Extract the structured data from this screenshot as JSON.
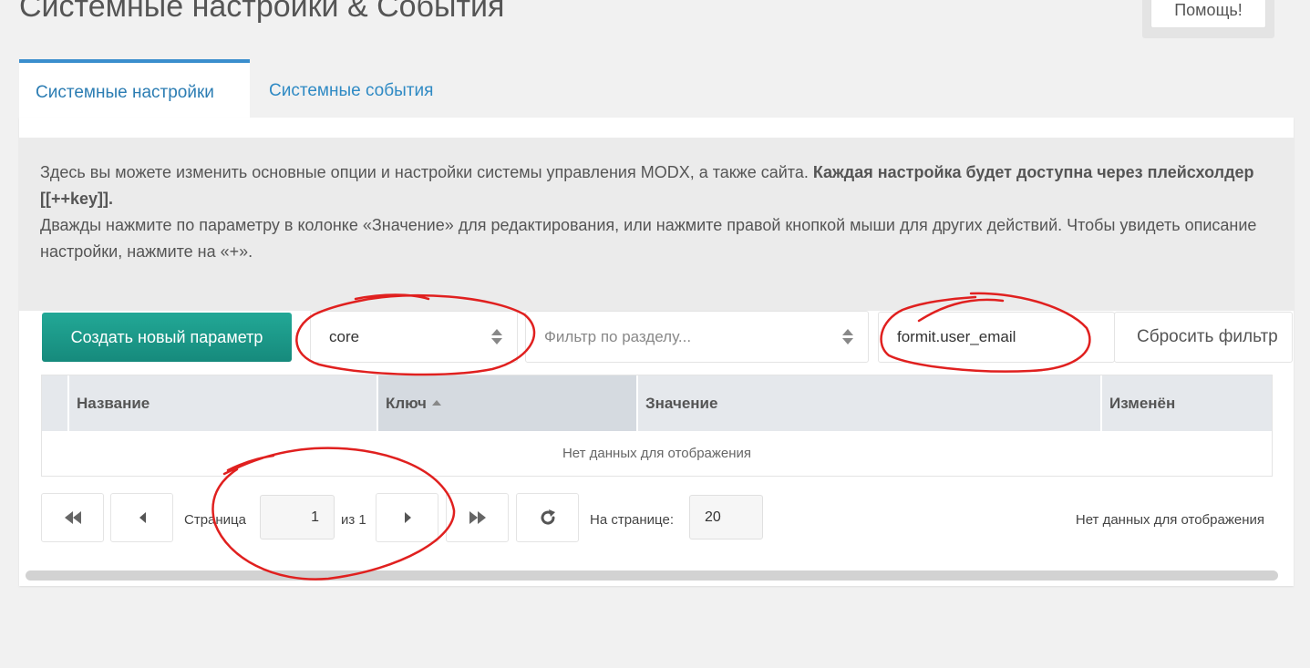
{
  "header": {
    "title": "Системные настройки & События",
    "help_label": "Помощь!"
  },
  "tabs": [
    {
      "label": "Системные настройки",
      "active": true
    },
    {
      "label": "Системные события",
      "active": false
    }
  ],
  "description": {
    "line1_normal": "Здесь вы можете изменить основные опции и настройки системы управления MODX, а также сайта. ",
    "line1_bold": "Каждая настройка будет доступна через плейсхолдер [[++key]].",
    "line2": "Дважды нажмите по параметру в колонке «Значение» для редактирования, или нажмите правой кнопкой мыши для других действий. Чтобы увидеть описание настройки, нажмите на «+»."
  },
  "toolbar": {
    "create_label": "Создать новый параметр",
    "namespace_value": "core",
    "area_placeholder": "Фильтр по разделу...",
    "search_value": "formit.user_email",
    "reset_label": "Сбросить фильтр"
  },
  "grid": {
    "columns": [
      "Название",
      "Ключ",
      "Значение",
      "Изменён"
    ],
    "sorted_column": "Ключ",
    "empty_text": "Нет данных для отображения"
  },
  "pager": {
    "page_label": "Страница",
    "page_value": "1",
    "of_label": "из 1",
    "per_page_label": "На странице:",
    "per_page_value": "20",
    "status_text": "Нет данных для отображения"
  },
  "colors": {
    "accent": "#3a8ecd",
    "create_button": "#1a9a8a",
    "annotation": "#e0201f"
  }
}
